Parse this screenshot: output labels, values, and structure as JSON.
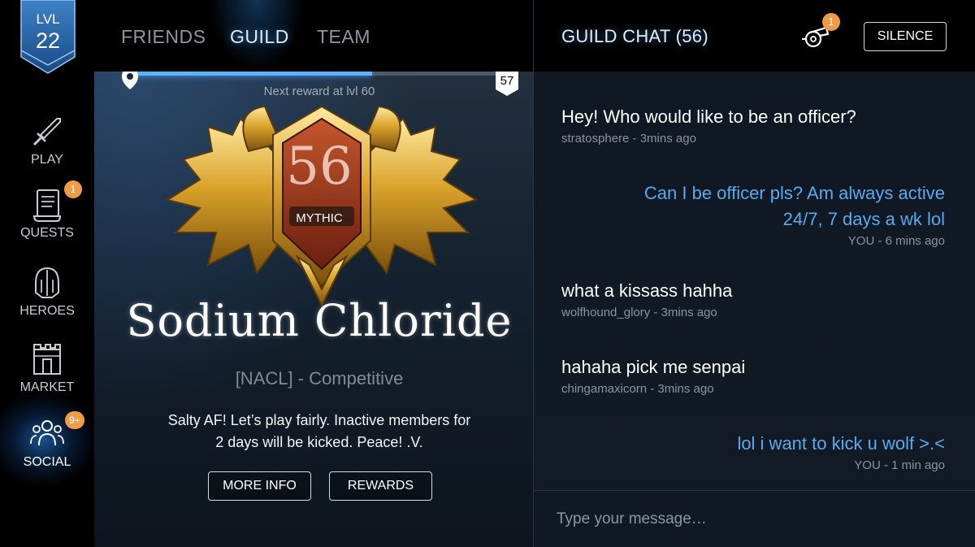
{
  "player": {
    "level_label": "LVL",
    "level": "22"
  },
  "nav": {
    "items": [
      {
        "label": "PLAY",
        "icon": "sword-icon"
      },
      {
        "label": "QUESTS",
        "icon": "scroll-icon",
        "badge": "1"
      },
      {
        "label": "HEROES",
        "icon": "helmet-icon"
      },
      {
        "label": "MARKET",
        "icon": "shop-icon"
      },
      {
        "label": "SOCIAL",
        "icon": "people-icon",
        "badge": "9+",
        "active": true
      }
    ]
  },
  "tabs": [
    {
      "label": "FRIENDS"
    },
    {
      "label": "GUILD",
      "active": true
    },
    {
      "label": "TEAM"
    }
  ],
  "guild": {
    "progress": 0.66,
    "next_level": "57",
    "next_reward": "Next reward at lvl 60",
    "rank_number": "56",
    "tier": "MYTHIC",
    "name": "Sodium Chloride",
    "tag_line": "[NACL] - Competitive",
    "description_line1": "Salty AF! Let’s play fairly. Inactive members for",
    "description_line2": "2 days will be kicked. Peace! .V.",
    "more_info_label": "MORE INFO",
    "rewards_label": "REWARDS"
  },
  "chat": {
    "title": "GUILD CHAT (56)",
    "notification_count": "1",
    "silence_label": "SILENCE",
    "input_placeholder": "Type your message…",
    "messages": [
      {
        "text": "Hey! Who would like to be an officer?",
        "meta": "stratosphere - 3mins ago",
        "mine": false
      },
      {
        "text_line1": "Can I be officer pls? Am always active",
        "text_line2": "24/7, 7 days a wk lol",
        "meta": "YOU - 6 mins ago",
        "mine": true
      },
      {
        "text": "what a kissass hahha",
        "meta": "wolfhound_glory - 3mins ago",
        "mine": false
      },
      {
        "text": "hahaha pick me senpai",
        "meta": "chingamaxicorn - 3mins ago",
        "mine": false
      },
      {
        "text": "lol i want to kick u wolf >.<",
        "meta": "YOU - 1 min ago",
        "mine": true
      }
    ]
  },
  "colors": {
    "accent": "#5aaaf0",
    "badge": "#f29b46",
    "gold": "#c9961e"
  }
}
